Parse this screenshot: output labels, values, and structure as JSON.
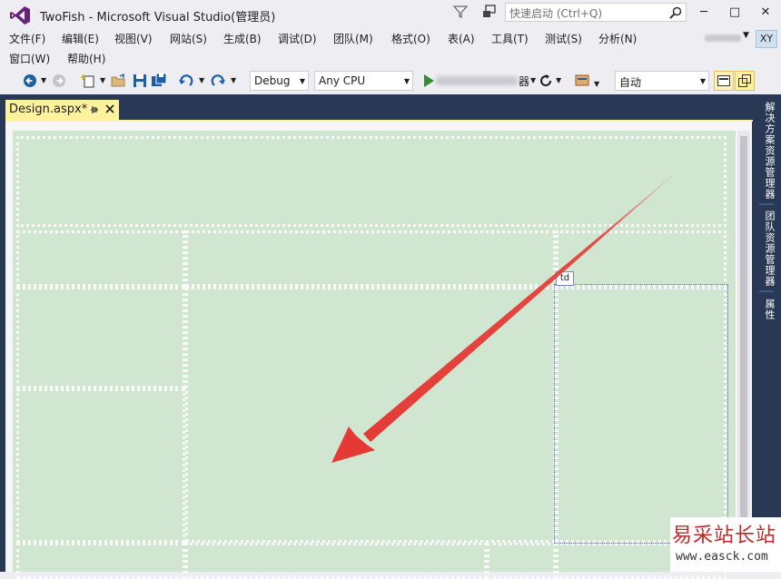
{
  "window": {
    "title": "TwoFish - Microsoft Visual Studio(管理员)",
    "quick_launch_placeholder": "快速启动 (Ctrl+Q)",
    "controls": {
      "minimize": "─",
      "restore": "□",
      "close": "✕"
    }
  },
  "menu": {
    "row1": [
      "文件(F)",
      "编辑(E)",
      "视图(V)",
      "网站(S)",
      "生成(B)",
      "调试(D)",
      "团队(M)",
      "格式(O)",
      "表(A)",
      "工具(T)",
      "测试(S)",
      "分析(N)"
    ],
    "row2": [
      "窗口(W)",
      "帮助(H)"
    ],
    "user_initials": "XY"
  },
  "toolbar": {
    "configuration": "Debug",
    "platform": "Any CPU",
    "run_suffix": "器",
    "zoom_mode": "自动",
    "icons": [
      "back-icon",
      "forward-icon",
      "new-project-icon",
      "open-folder-icon",
      "save-icon",
      "save-all-icon",
      "undo-icon",
      "redo-icon",
      "start-icon",
      "refresh-icon",
      "browser-link-icon",
      "design-view-icon",
      "split-view-icon"
    ]
  },
  "document": {
    "tab_label": "Design.aspx*",
    "selected_tag": "td"
  },
  "side_panels": [
    "解决方案资源管理器",
    "团队资源管理器",
    "属性"
  ],
  "watermark": {
    "title": "易采站长站",
    "url": "www.easck.com"
  },
  "colors": {
    "design_surface": "#d0e6d1",
    "dark_chrome": "#293955",
    "active_tab": "#fff29d",
    "arrow": "#e53935",
    "vs_purple": "#68217a"
  }
}
